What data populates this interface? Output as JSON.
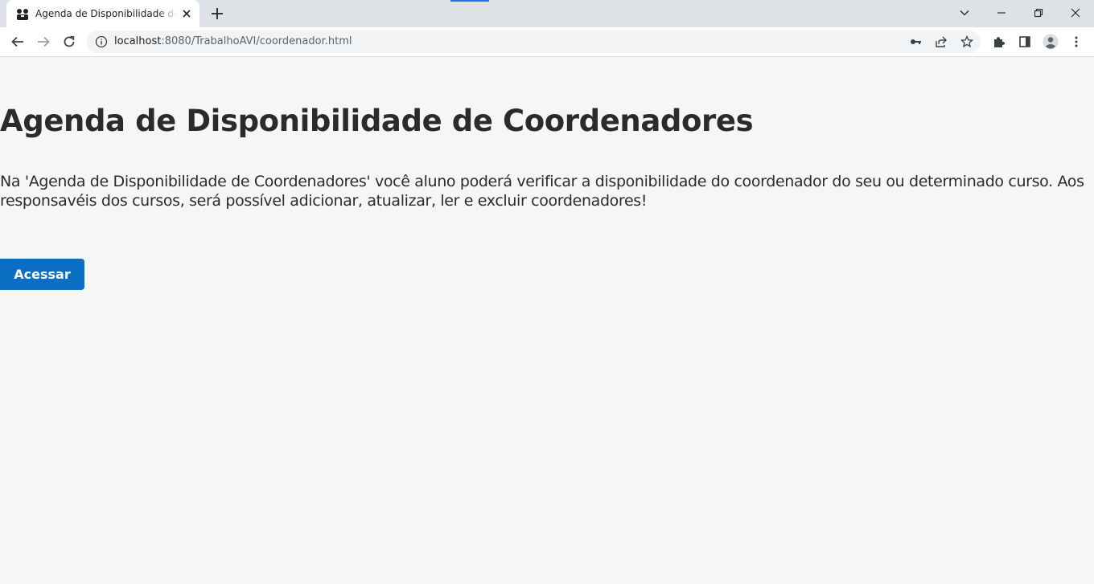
{
  "browser": {
    "tab": {
      "title": "Agenda de Disponibilidade de Coordenadores",
      "favicon": "app-favicon-icon"
    },
    "address_bar": {
      "host": "localhost",
      "path": ":8080/TrabalhoAVI/coordenador.html"
    },
    "icons": {
      "back": "back-arrow-icon",
      "forward": "forward-arrow-icon",
      "reload": "reload-icon",
      "site_info": "info-icon",
      "password": "key-icon",
      "share": "share-icon",
      "bookmark": "star-icon",
      "extensions": "puzzle-icon",
      "side_panel": "side-panel-icon",
      "profile": "profile-icon",
      "menu": "kebab-menu-icon",
      "tab_search": "chevron-down-icon",
      "minimize": "minimize-icon",
      "restore": "restore-icon",
      "close_window": "close-icon"
    },
    "colors": {
      "tabstrip": "#dee1e6",
      "loading_accent": "#1a73e8"
    }
  },
  "page": {
    "title": "Agenda de Disponibilidade de Coordenadores",
    "description": "Na 'Agenda de Disponibilidade de Coordenadores' você aluno poderá verificar a disponibilidade do coordenador do seu ou determinado curso. Aos responsavéis dos cursos, será possível adicionar, atualizar, ler e excluir coordenadores!",
    "button_label": "Acessar",
    "colors": {
      "background": "#f6f6f6",
      "text": "#2b2b2b",
      "button": "#0a6fc2"
    }
  }
}
